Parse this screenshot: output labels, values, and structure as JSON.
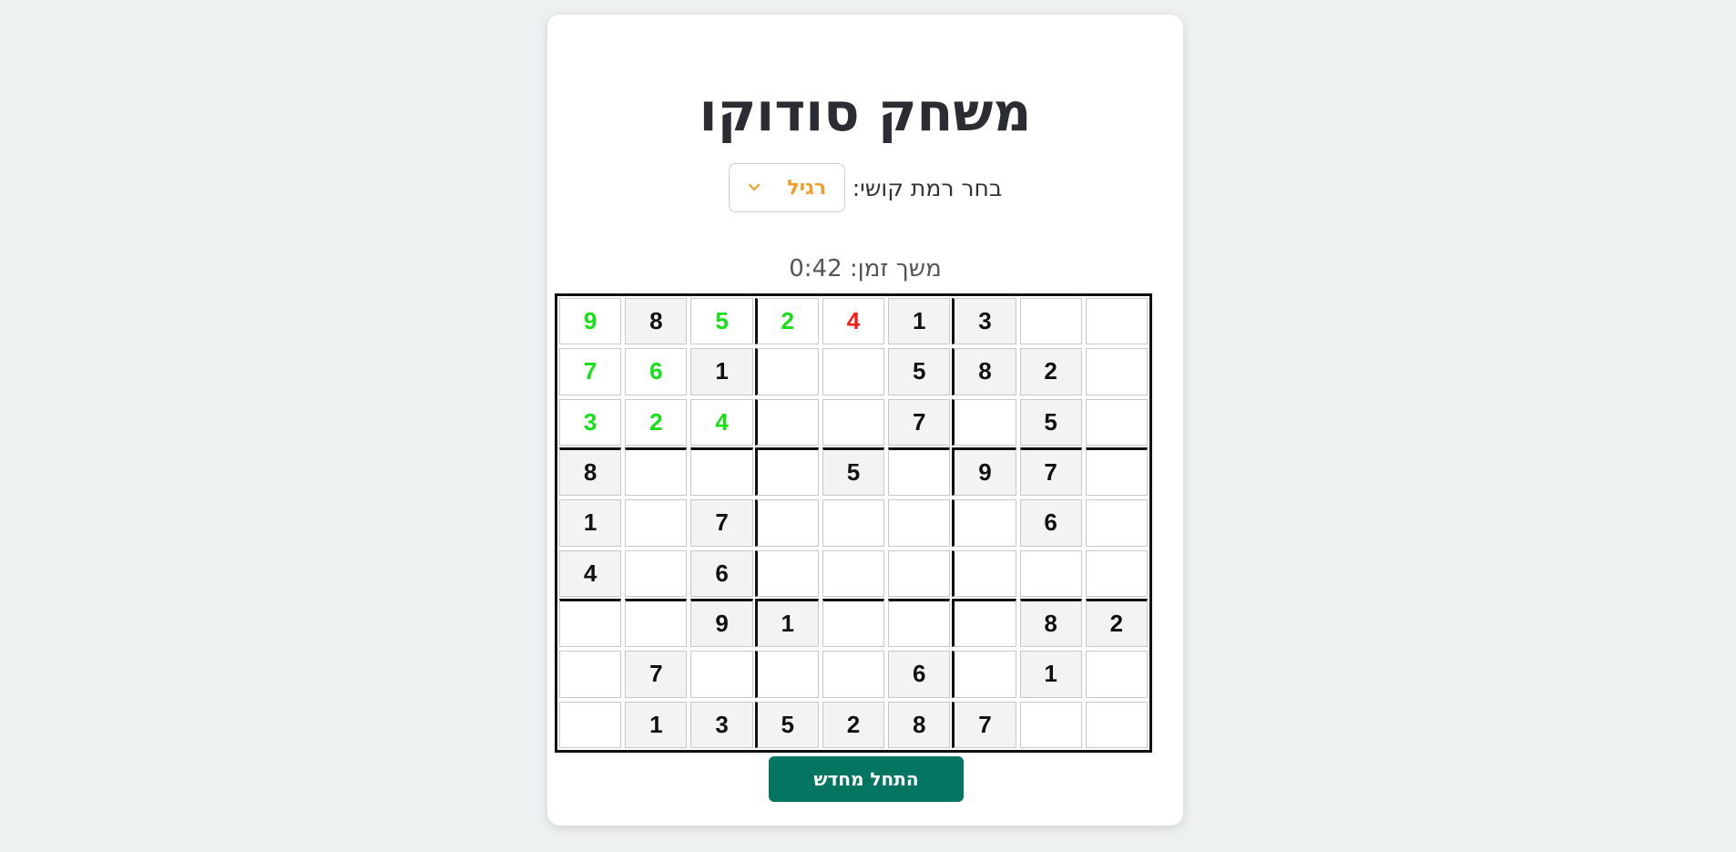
{
  "title": "משחק סודוקו",
  "difficulty": {
    "label": "בחר רמת קושי:",
    "selected": "רגיל"
  },
  "timer": {
    "text": "משך זמן: 0:42"
  },
  "restart_label": "התחל מחדש",
  "colors": {
    "accent": "#047561",
    "difficulty_text": "#f29f2a",
    "correct_entry": "#16e016",
    "wrong_entry": "#ff1a1a"
  },
  "board": [
    [
      {
        "v": "9",
        "t": "correct"
      },
      {
        "v": "8",
        "t": "given"
      },
      {
        "v": "5",
        "t": "correct"
      },
      {
        "v": "2",
        "t": "correct"
      },
      {
        "v": "4",
        "t": "wrong"
      },
      {
        "v": "1",
        "t": "given"
      },
      {
        "v": "3",
        "t": "given"
      },
      {
        "v": "",
        "t": "empty"
      },
      {
        "v": "",
        "t": "empty"
      }
    ],
    [
      {
        "v": "7",
        "t": "correct"
      },
      {
        "v": "6",
        "t": "correct"
      },
      {
        "v": "1",
        "t": "given"
      },
      {
        "v": "",
        "t": "empty"
      },
      {
        "v": "",
        "t": "empty"
      },
      {
        "v": "5",
        "t": "given"
      },
      {
        "v": "8",
        "t": "given"
      },
      {
        "v": "2",
        "t": "given"
      },
      {
        "v": "",
        "t": "empty"
      }
    ],
    [
      {
        "v": "3",
        "t": "correct"
      },
      {
        "v": "2",
        "t": "correct"
      },
      {
        "v": "4",
        "t": "correct"
      },
      {
        "v": "",
        "t": "empty"
      },
      {
        "v": "",
        "t": "empty"
      },
      {
        "v": "7",
        "t": "given"
      },
      {
        "v": "",
        "t": "empty"
      },
      {
        "v": "5",
        "t": "given"
      },
      {
        "v": "",
        "t": "empty"
      }
    ],
    [
      {
        "v": "8",
        "t": "given"
      },
      {
        "v": "",
        "t": "empty"
      },
      {
        "v": "",
        "t": "empty"
      },
      {
        "v": "",
        "t": "empty"
      },
      {
        "v": "5",
        "t": "given"
      },
      {
        "v": "",
        "t": "empty"
      },
      {
        "v": "9",
        "t": "given"
      },
      {
        "v": "7",
        "t": "given"
      },
      {
        "v": "",
        "t": "empty"
      }
    ],
    [
      {
        "v": "1",
        "t": "given"
      },
      {
        "v": "",
        "t": "empty"
      },
      {
        "v": "7",
        "t": "given"
      },
      {
        "v": "",
        "t": "empty"
      },
      {
        "v": "",
        "t": "empty"
      },
      {
        "v": "",
        "t": "empty"
      },
      {
        "v": "",
        "t": "empty"
      },
      {
        "v": "6",
        "t": "given"
      },
      {
        "v": "",
        "t": "empty"
      }
    ],
    [
      {
        "v": "4",
        "t": "given"
      },
      {
        "v": "",
        "t": "empty"
      },
      {
        "v": "6",
        "t": "given"
      },
      {
        "v": "",
        "t": "empty"
      },
      {
        "v": "",
        "t": "empty"
      },
      {
        "v": "",
        "t": "empty"
      },
      {
        "v": "",
        "t": "empty"
      },
      {
        "v": "",
        "t": "empty"
      },
      {
        "v": "",
        "t": "empty"
      }
    ],
    [
      {
        "v": "",
        "t": "empty"
      },
      {
        "v": "",
        "t": "empty"
      },
      {
        "v": "9",
        "t": "given"
      },
      {
        "v": "1",
        "t": "given"
      },
      {
        "v": "",
        "t": "empty"
      },
      {
        "v": "",
        "t": "empty"
      },
      {
        "v": "",
        "t": "empty"
      },
      {
        "v": "8",
        "t": "given"
      },
      {
        "v": "2",
        "t": "given"
      }
    ],
    [
      {
        "v": "",
        "t": "empty"
      },
      {
        "v": "7",
        "t": "given"
      },
      {
        "v": "",
        "t": "empty"
      },
      {
        "v": "",
        "t": "empty"
      },
      {
        "v": "",
        "t": "empty"
      },
      {
        "v": "6",
        "t": "given"
      },
      {
        "v": "",
        "t": "empty"
      },
      {
        "v": "1",
        "t": "given"
      },
      {
        "v": "",
        "t": "empty"
      }
    ],
    [
      {
        "v": "",
        "t": "empty"
      },
      {
        "v": "1",
        "t": "given"
      },
      {
        "v": "3",
        "t": "given"
      },
      {
        "v": "5",
        "t": "given"
      },
      {
        "v": "2",
        "t": "given"
      },
      {
        "v": "8",
        "t": "given"
      },
      {
        "v": "7",
        "t": "given"
      },
      {
        "v": "",
        "t": "empty"
      },
      {
        "v": "",
        "t": "empty"
      }
    ]
  ]
}
